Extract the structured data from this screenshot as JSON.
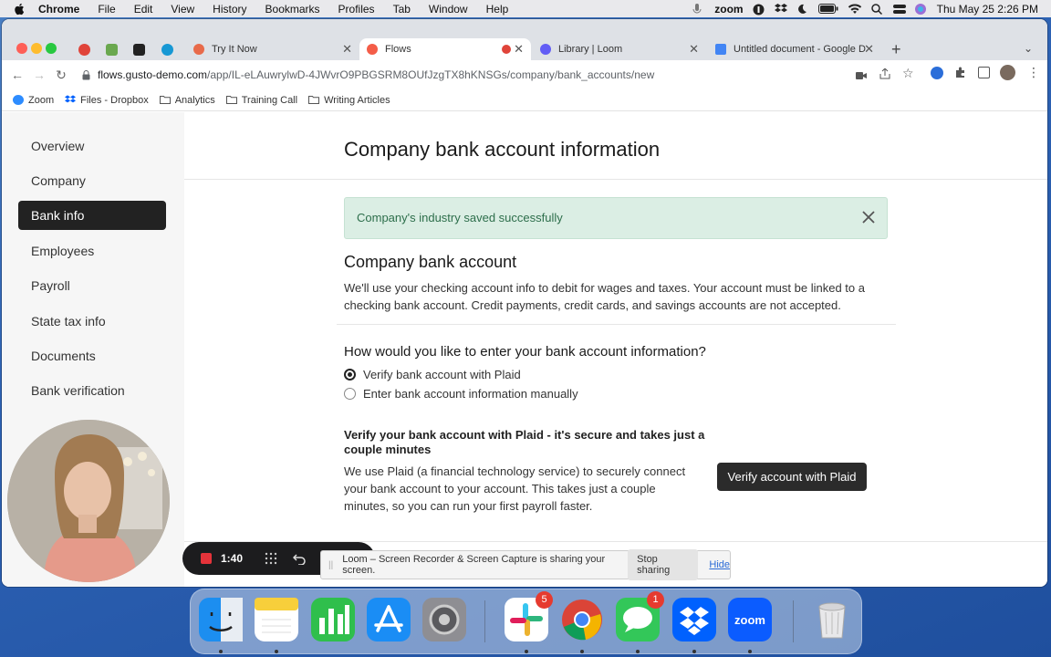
{
  "menubar": {
    "app_name": "Chrome",
    "menus": [
      "File",
      "Edit",
      "View",
      "History",
      "Bookmarks",
      "Profiles",
      "Tab",
      "Window",
      "Help"
    ],
    "zoom_label": "zoom",
    "datetime": "Thu May 25  2:26 PM"
  },
  "browser": {
    "tabs": [
      {
        "title": "Try It Now",
        "favicon_color": "#e86a4a"
      },
      {
        "title": "Flows",
        "favicon_color": "#f45d48"
      },
      {
        "title": "Library | Loom",
        "favicon_color": "#625df5"
      },
      {
        "title": "Untitled document - Google Do",
        "favicon_color": "#4285f4"
      }
    ],
    "url_host": "flows.gusto-demo.com",
    "url_path": "/app/IL-eLAuwrylwD-4JWvrO9PBGSRM8OUfJzgTX8hKNSGs/company/bank_accounts/new",
    "bookmarks": [
      {
        "label": "Zoom",
        "icon": "zoom-icon"
      },
      {
        "label": "Files - Dropbox",
        "icon": "dropbox-icon"
      },
      {
        "label": "Analytics",
        "icon": "folder-icon"
      },
      {
        "label": "Training Call",
        "icon": "folder-icon"
      },
      {
        "label": "Writing Articles",
        "icon": "folder-icon"
      }
    ]
  },
  "sidebar": {
    "items": [
      {
        "label": "Overview"
      },
      {
        "label": "Company"
      },
      {
        "label": "Bank info"
      },
      {
        "label": "Employees"
      },
      {
        "label": "Payroll"
      },
      {
        "label": "State tax info"
      },
      {
        "label": "Documents"
      },
      {
        "label": "Bank verification"
      }
    ],
    "active_index": 2
  },
  "main": {
    "title": "Company bank account information",
    "alert": "Company's industry saved successfully",
    "section_title": "Company bank account",
    "section_desc": "We'll use your checking account info to debit for wages and taxes. Your account must be linked to a checking bank account. Credit payments, credit cards, and savings accounts are not accepted.",
    "question": "How would you like to enter your bank account information?",
    "options": [
      {
        "label": "Verify bank account with Plaid",
        "selected": true
      },
      {
        "label": "Enter bank account information manually",
        "selected": false
      }
    ],
    "verify_title": "Verify your bank account with Plaid - it's secure and takes just a couple minutes",
    "verify_desc": "We use Plaid (a financial technology service) to securely connect your bank account to your account. This takes just a couple minutes, so you can run your first payroll faster.",
    "verify_button": "Verify account with Plaid"
  },
  "loom": {
    "timer": "1:40"
  },
  "share_bar": {
    "message": "Loom – Screen Recorder & Screen Capture is sharing your screen.",
    "stop": "Stop sharing",
    "hide": "Hide"
  },
  "dock": {
    "apps": [
      "Finder",
      "Notes",
      "Numbers",
      "App Store",
      "System Preferences",
      "Slack",
      "Chrome",
      "Messages",
      "Dropbox",
      "Zoom",
      "Trash"
    ],
    "slack_badge": "5",
    "messages_badge": "1",
    "zoom_label": "zoom"
  },
  "colors": {
    "accent_dark": "#222222",
    "alert_bg": "#dbeee4",
    "alert_text": "#2d6e4b"
  }
}
